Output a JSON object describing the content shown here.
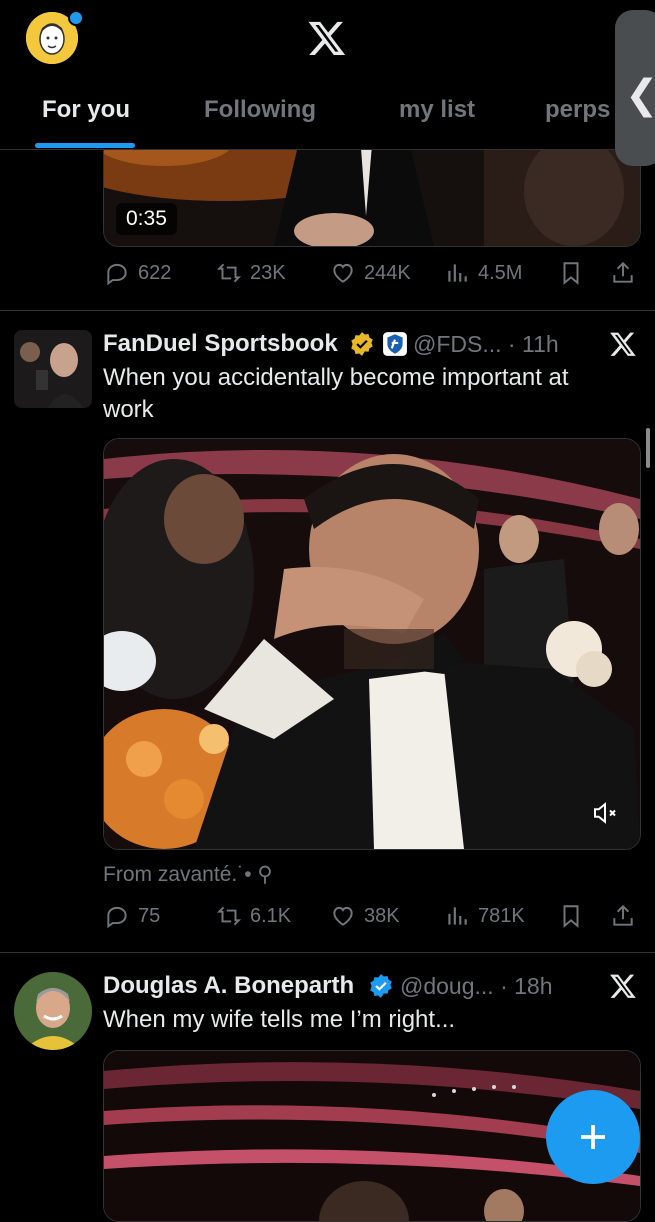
{
  "header": {
    "tabs": [
      {
        "label": "For you",
        "active": true
      },
      {
        "label": "Following",
        "active": false
      },
      {
        "label": "my list",
        "active": false
      },
      {
        "label": "perps",
        "active": false
      }
    ],
    "side_handle_glyph": "❮"
  },
  "tweets": [
    {
      "video_time": "0:35",
      "stats": {
        "replies": "622",
        "reposts": "23K",
        "likes": "244K",
        "views": "4.5M"
      }
    },
    {
      "name": "FanDuel Sportsbook",
      "handle": "@FDS...",
      "time": "11h",
      "text": "When you accidentally become important at work",
      "from": "From zavanté.˙• ⚲",
      "stats": {
        "replies": "75",
        "reposts": "6.1K",
        "likes": "38K",
        "views": "781K"
      }
    },
    {
      "name": "Douglas A. Boneparth",
      "handle": "@doug...",
      "time": "18h",
      "text": "When my wife tells me I’m right..."
    }
  ],
  "colors": {
    "accent": "#1d9bf0",
    "verified_gold": "#e8b829",
    "muted": "#71767b"
  },
  "icons": [
    "x-logo-icon",
    "reply-icon",
    "repost-icon",
    "like-icon",
    "views-icon",
    "bookmark-icon",
    "share-icon",
    "verified-icon",
    "mute-icon",
    "plus-icon"
  ]
}
